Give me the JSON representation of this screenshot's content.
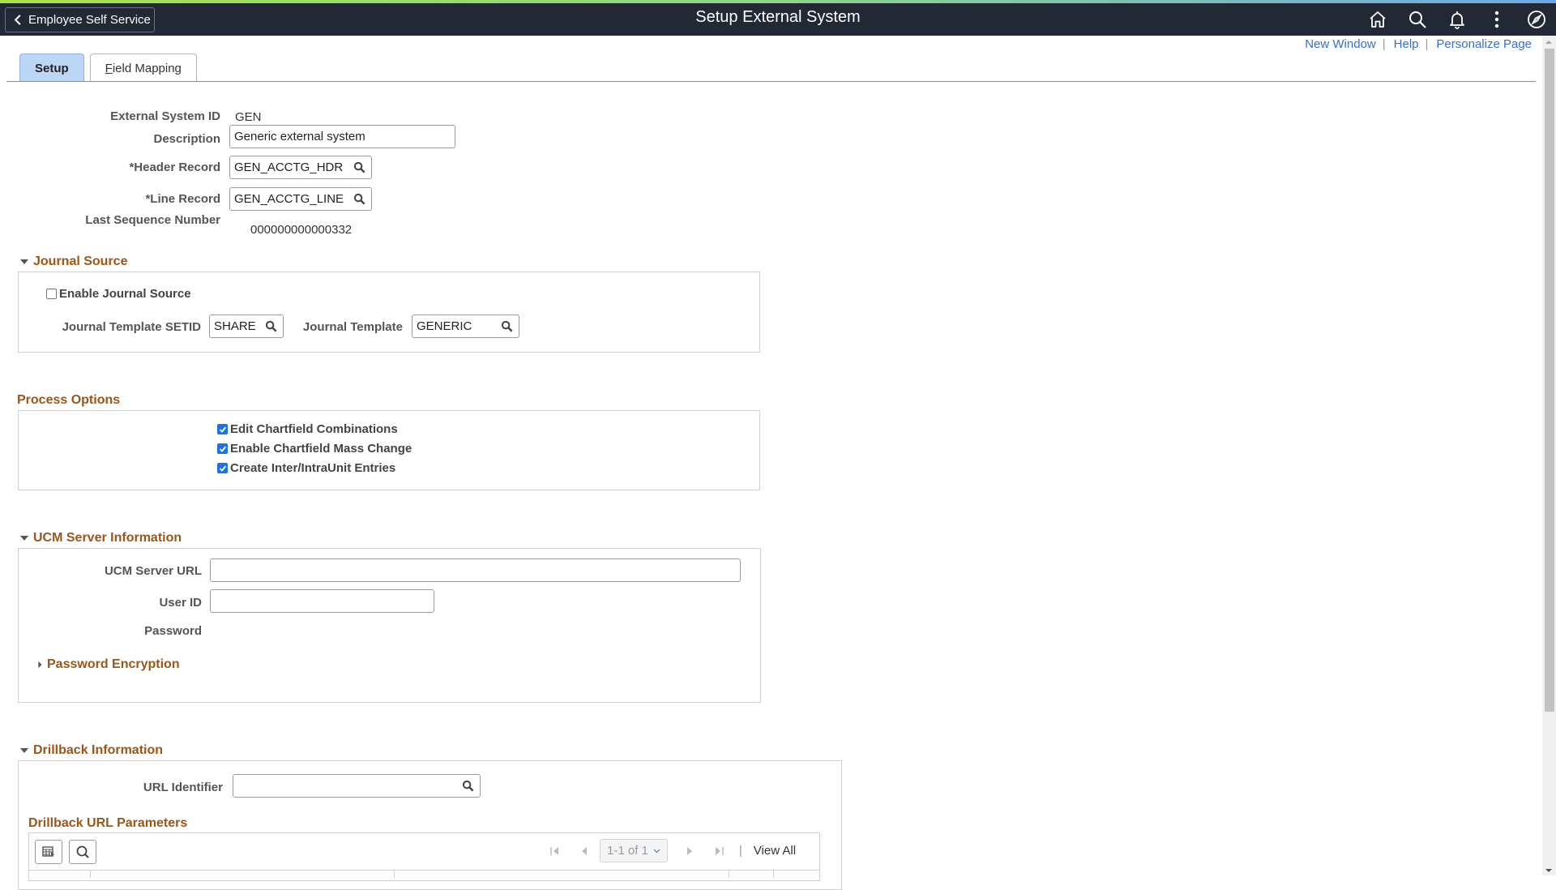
{
  "header": {
    "back_label": "Employee Self Service",
    "title": "Setup External System",
    "icons": [
      "home-icon",
      "search-icon",
      "bell-icon",
      "more-vertical-icon",
      "compass-icon"
    ]
  },
  "links": {
    "new_window": "New Window",
    "help": "Help",
    "personalize": "Personalize Page",
    "separator": "|"
  },
  "tabs": [
    {
      "label": "Setup",
      "active": true
    },
    {
      "label": "Field Mapping",
      "accesskey": "F",
      "rest": "ield Mapping",
      "active": false
    }
  ],
  "form": {
    "external_system_id": {
      "label": "External System ID",
      "value": "GEN"
    },
    "description": {
      "label": "Description",
      "value": "Generic external system"
    },
    "header_record": {
      "label": "*Header Record",
      "value": "GEN_ACCTG_HDR"
    },
    "line_record": {
      "label": "*Line Record",
      "value": "GEN_ACCTG_LINE"
    },
    "last_sequence": {
      "label": "Last Sequence Number",
      "value": "000000000000332"
    }
  },
  "journal_source": {
    "title": "Journal Source",
    "enable": {
      "label": "Enable Journal Source",
      "checked": false
    },
    "template_setid": {
      "label": "Journal Template SETID",
      "value": "SHARE"
    },
    "template": {
      "label": "Journal Template",
      "value": "GENERIC"
    }
  },
  "process_options": {
    "title": "Process Options",
    "options": [
      {
        "label": "Edit Chartfield Combinations",
        "checked": true
      },
      {
        "label": "Enable Chartfield Mass Change",
        "checked": true
      },
      {
        "label": "Create Inter/IntraUnit Entries",
        "checked": true
      }
    ]
  },
  "ucm": {
    "title": "UCM Server Information",
    "server_url": {
      "label": "UCM Server URL",
      "value": ""
    },
    "user_id": {
      "label": "User ID",
      "value": ""
    },
    "password": {
      "label": "Password"
    },
    "password_encryption": "Password Encryption"
  },
  "drillback": {
    "title": "Drillback Information",
    "url_identifier": {
      "label": "URL Identifier",
      "value": ""
    },
    "params_title": "Drillback URL Parameters",
    "pager": {
      "range": "1-1 of 1",
      "view_all": "View All",
      "separator": "|"
    }
  },
  "colors": {
    "header_bg": "#222834",
    "section_title": "#9a5619",
    "link": "#3a6ec8",
    "active_tab": "#bcd7f5",
    "checkbox": "#1a73e8"
  }
}
